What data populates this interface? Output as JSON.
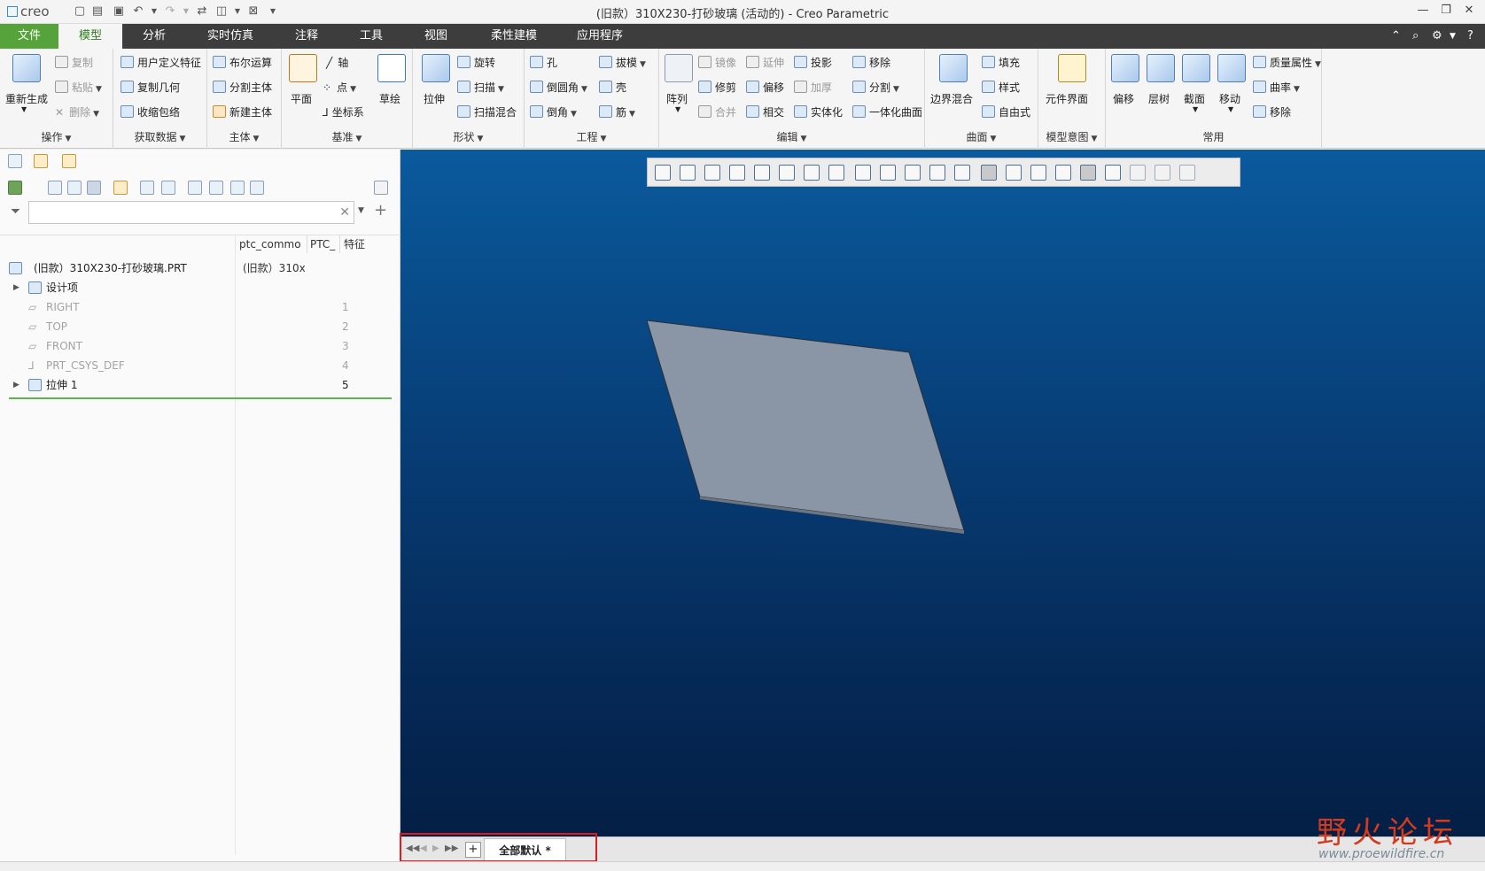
{
  "app": {
    "logo_text": "creo",
    "title": "(旧款）310X230-打砂玻璃 (活动的) - Creo Parametric"
  },
  "tabs": [
    "文件",
    "模型",
    "分析",
    "实时仿真",
    "注释",
    "工具",
    "视图",
    "柔性建模",
    "应用程序"
  ],
  "ribbon": {
    "ops": {
      "regen": "重新生成",
      "copy": "复制",
      "paste": "粘贴",
      "delete": "删除",
      "group": "操作"
    },
    "get_data": {
      "udf": "用户定义特征",
      "copy_geom": "复制几何",
      "shrinkwrap": "收缩包络",
      "group": "获取数据"
    },
    "body": {
      "boolean": "布尔运算",
      "split_body": "分割主体",
      "new_body": "新建主体",
      "group": "主体"
    },
    "datum": {
      "plane": "平面",
      "axis": "轴",
      "point": "点",
      "csys": "坐标系",
      "sketch": "草绘",
      "group": "基准"
    },
    "shapes": {
      "extrude": "拉伸",
      "revolve": "旋转",
      "sweep": "扫描",
      "swept_blend": "扫描混合",
      "group": "形状"
    },
    "eng": {
      "hole": "孔",
      "round": "倒圆角",
      "chamfer": "倒角",
      "draft": "拔模",
      "shell": "壳",
      "rib": "筋",
      "group": "工程"
    },
    "edit": {
      "pattern": "阵列",
      "mirror": "镜像",
      "trim": "修剪",
      "merge": "合并",
      "extend": "延伸",
      "offset": "偏移",
      "intersect": "相交",
      "project": "投影",
      "thicken": "加厚",
      "solidify": "实体化",
      "remove": "移除",
      "split": "分割",
      "unify": "一体化曲面",
      "group": "编辑"
    },
    "surfaces": {
      "boundary": "边界混合",
      "fill": "填充",
      "style": "样式",
      "freestyle": "自由式",
      "group": "曲面"
    },
    "intent": {
      "component_interface": "元件界面",
      "group": "模型意图"
    },
    "common": {
      "offset": "偏移",
      "layer_tree": "层树",
      "section": "截面",
      "move": "移动",
      "mass_props": "质量属性",
      "curvature": "曲率",
      "remove": "移除",
      "group": "常用"
    }
  },
  "model_tree": {
    "filter_placeholder": "",
    "columns": [
      "ptc_commo",
      "PTC_",
      "特征"
    ],
    "root": {
      "name": "(旧款）310X230-打砂玻璃.PRT",
      "col1": "(旧款）310x"
    },
    "items": [
      {
        "name": "设计项",
        "num": ""
      },
      {
        "name": "RIGHT",
        "num": "1"
      },
      {
        "name": "TOP",
        "num": "2"
      },
      {
        "name": "FRONT",
        "num": "3"
      },
      {
        "name": "PRT_CSYS_DEF",
        "num": "4"
      },
      {
        "name": "拉伸 1",
        "num": "5"
      }
    ]
  },
  "view_tabs": {
    "add": "+",
    "active_tab": "全部默认 *"
  },
  "watermark": {
    "text": "野火论坛",
    "url": "www.proewildfire.cn"
  },
  "colors": {
    "accent_green": "#55a33a",
    "viewport_top": "#0a5a9d",
    "viewport_bottom": "#041f45",
    "highlight_red": "#e01b1b",
    "part_face": "#8a96a6"
  }
}
